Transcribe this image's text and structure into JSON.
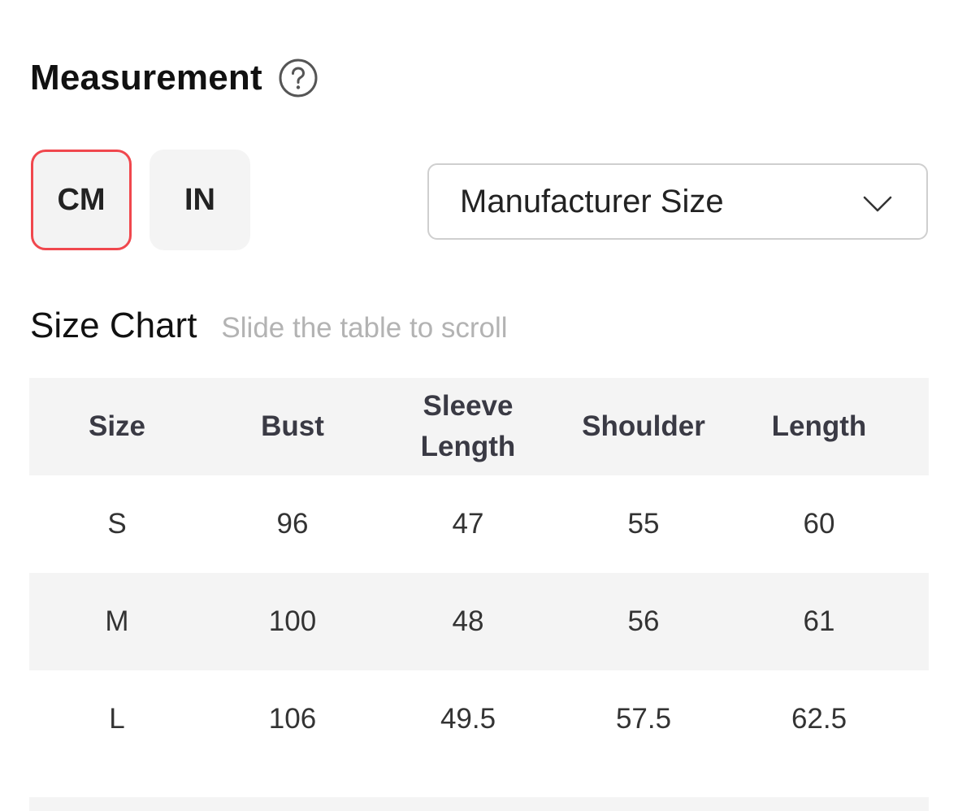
{
  "measurement": {
    "title": "Measurement",
    "help_icon": "question-circle-icon"
  },
  "units": {
    "cm_label": "CM",
    "in_label": "IN",
    "selected": "CM",
    "selected_border_color": "#f0474d"
  },
  "size_select": {
    "value": "Manufacturer Size",
    "icon": "chevron-down-icon"
  },
  "size_chart": {
    "title": "Size Chart",
    "hint": "Slide the table to scroll",
    "headers": [
      "Size",
      "Bust",
      "Sleeve Length",
      "Shoulder",
      "Length"
    ],
    "rows": [
      [
        "S",
        "96",
        "47",
        "55",
        "60"
      ],
      [
        "M",
        "100",
        "48",
        "56",
        "61"
      ],
      [
        "L",
        "106",
        "49.5",
        "57.5",
        "62.5"
      ]
    ]
  }
}
